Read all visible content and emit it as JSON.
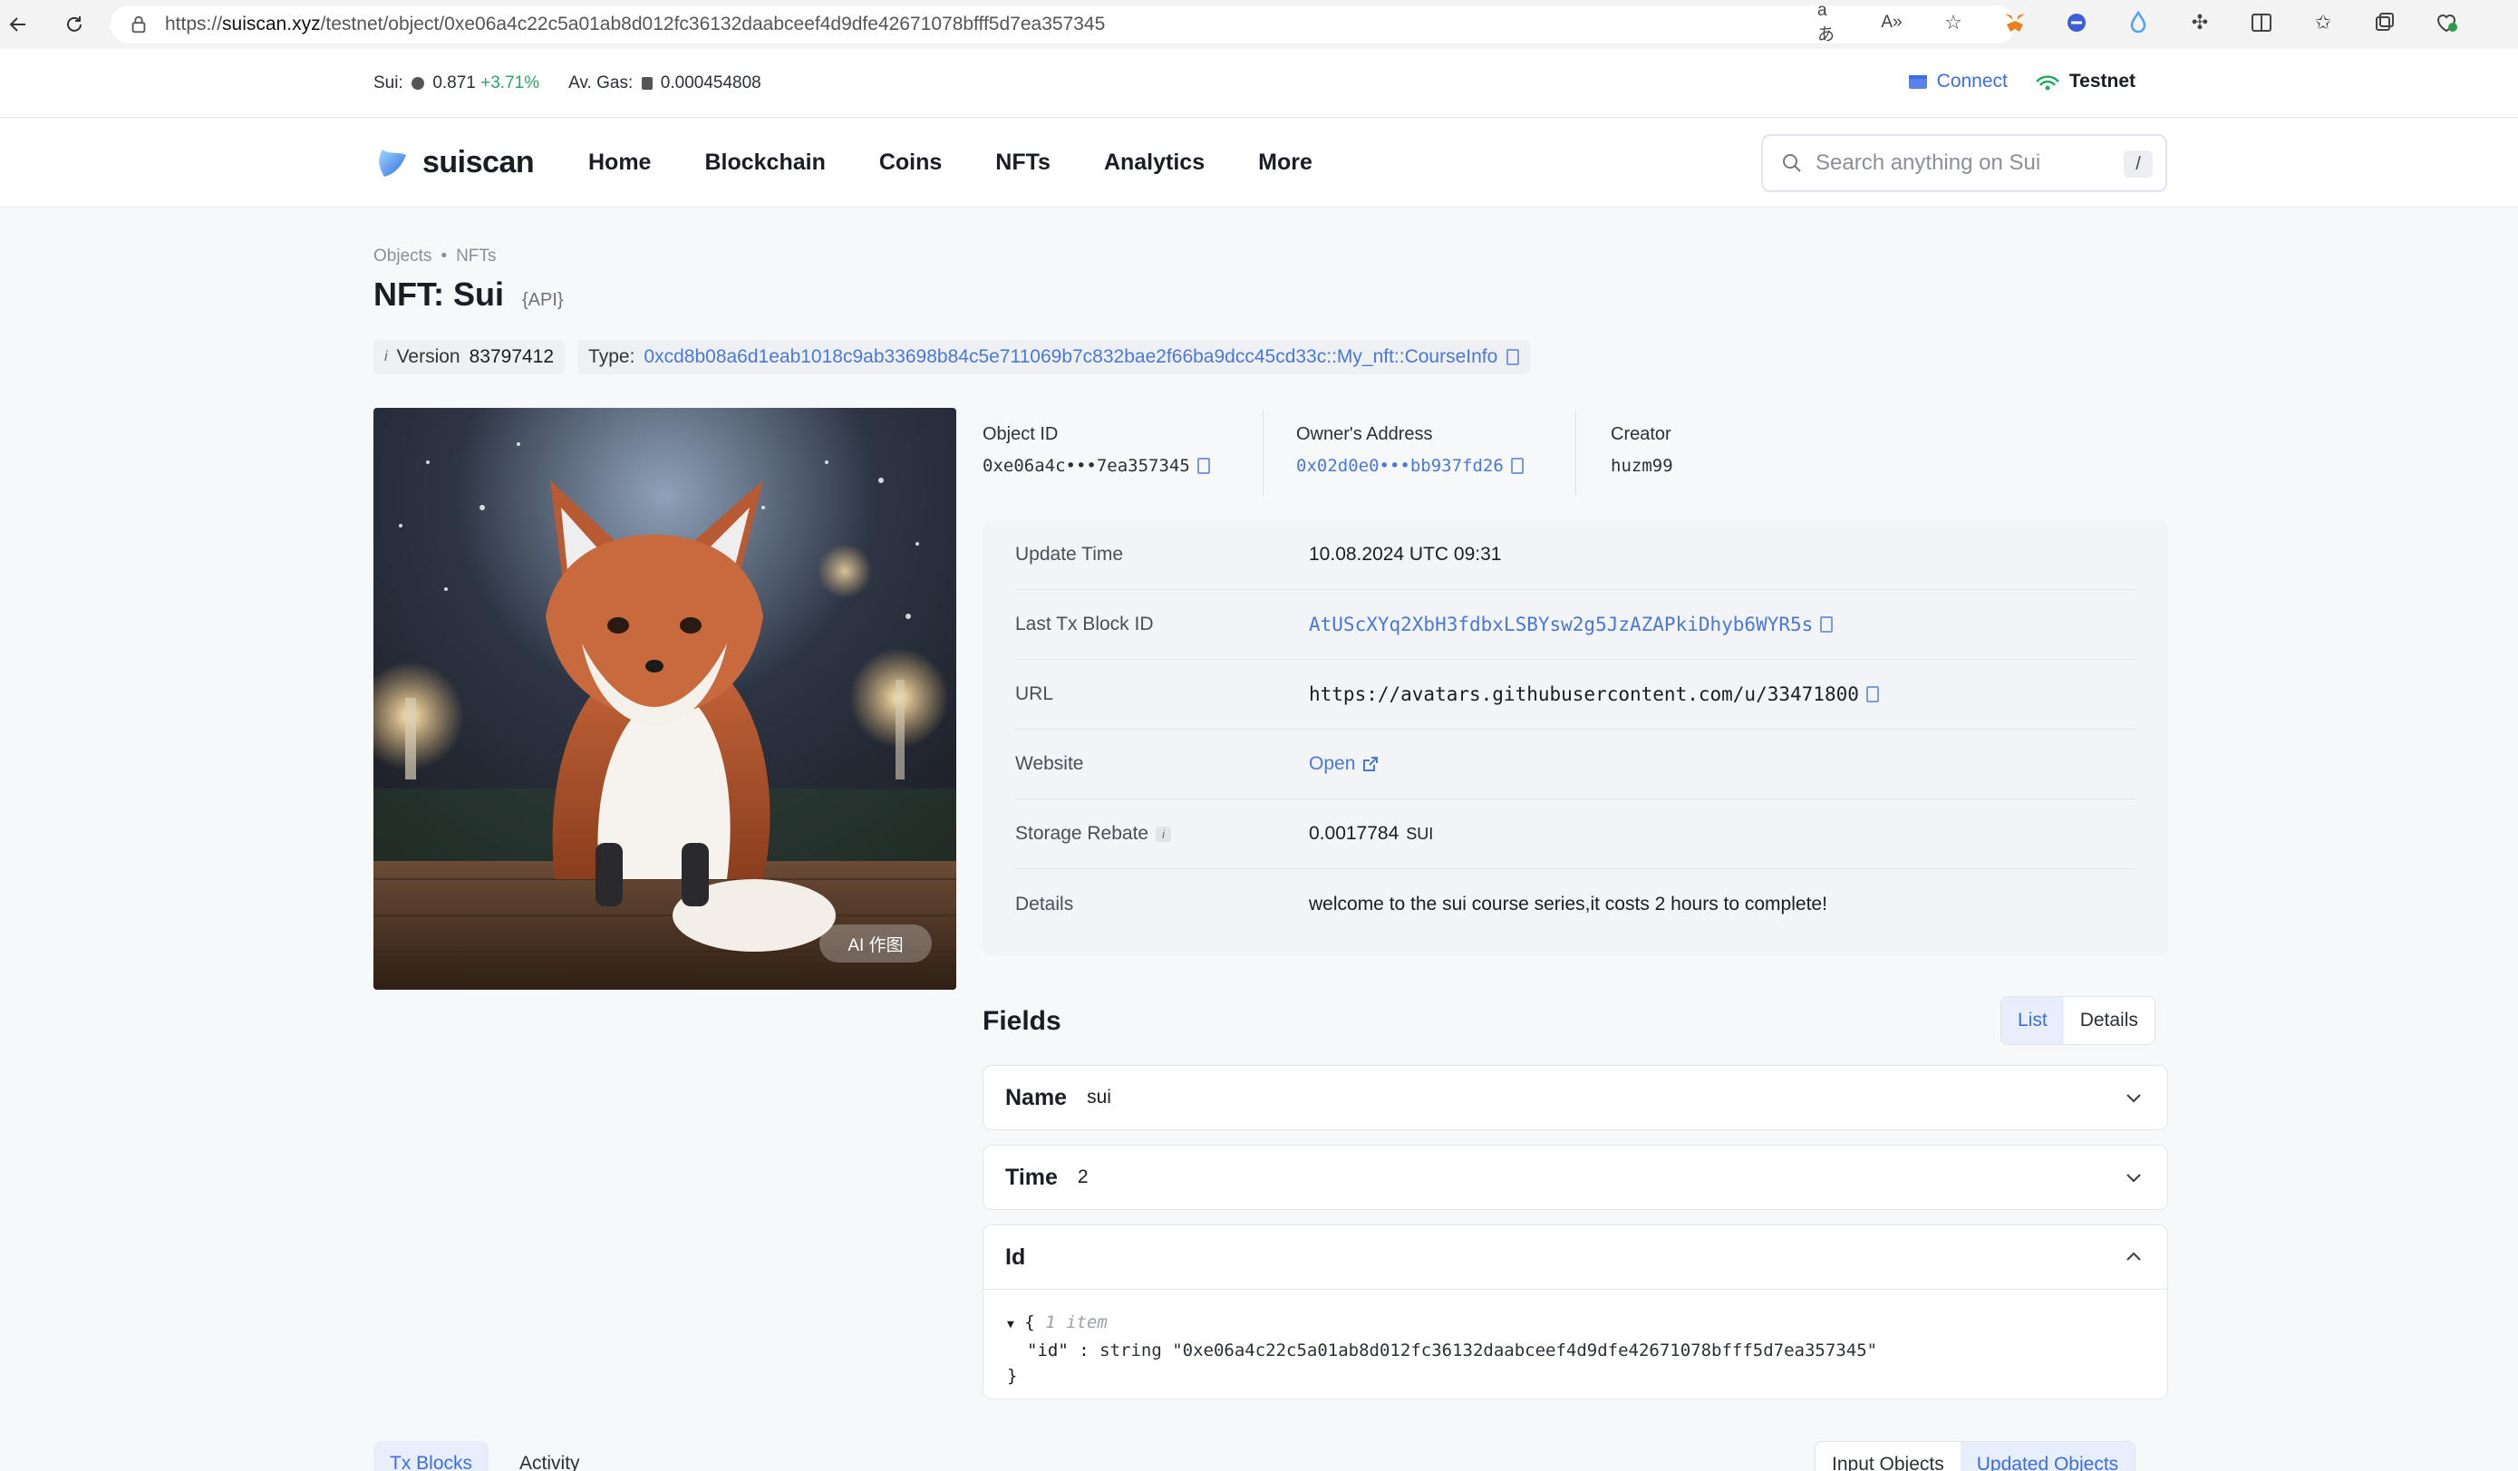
{
  "browser": {
    "url_prefix": "https://",
    "url_host": "suiscan.xyz",
    "url_path": "/testnet/object/0xe06a4c22c5a01ab8d012fc36132daabceef4d9dfe42671078bfff5d7ea357345"
  },
  "ticker": {
    "sui_label": "Sui:",
    "sui_price": "0.871",
    "sui_change": "+3.71%",
    "gas_label": "Av. Gas:",
    "gas_value": "0.000454808",
    "connect_label": "Connect",
    "network_label": "Testnet"
  },
  "nav": {
    "brand": "suiscan",
    "items": [
      "Home",
      "Blockchain",
      "Coins",
      "NFTs",
      "Analytics",
      "More"
    ],
    "search_placeholder": "Search anything on Sui",
    "search_shortcut": "/"
  },
  "breadcrumb": {
    "items": [
      "Objects",
      "NFTs"
    ],
    "separator": "•"
  },
  "page": {
    "title": "NFT: Sui",
    "api_tag": "{API}",
    "version_label": "Version",
    "version_value": "83797412",
    "type_label": "Type:",
    "type_value": "0xcd8b08a6d1eab1018c9ab33698b84c5e711069b7c832bae2f66ba9dcc45cd33c::My_nft::CourseInfo",
    "image_badge": "AI 作图"
  },
  "ids": {
    "object_id_label": "Object ID",
    "object_id_value": "0xe06a4c•••7ea357345",
    "owner_label": "Owner's Address",
    "owner_value": "0x02d0e0•••bb937fd26",
    "creator_label": "Creator",
    "creator_value": "huzm99"
  },
  "properties": [
    {
      "label": "Update Time",
      "value": "10.08.2024 UTC 09:31"
    },
    {
      "label": "Last Tx Block ID",
      "value": "AtUScXYq2XbH3fdbxLSBYsw2g5JzAZAPkiDhyb6WYR5s"
    },
    {
      "label": "URL",
      "value": "https://avatars.githubusercontent.com/u/33471800"
    },
    {
      "label": "Website",
      "value": "Open"
    },
    {
      "label": "Storage Rebate",
      "value": "0.0017784",
      "unit": "SUI"
    },
    {
      "label": "Details",
      "value": "welcome to the sui course series,it costs 2 hours to complete!"
    }
  ],
  "fields": {
    "title": "Fields",
    "view_list": "List",
    "view_details": "Details",
    "items": [
      {
        "name": "Name",
        "value": "sui"
      },
      {
        "name": "Time",
        "value": "2"
      },
      {
        "name": "Id",
        "value": ""
      }
    ],
    "json": {
      "open_brace": "{",
      "count": "1 item",
      "key": "\"id\"",
      "colon": ":",
      "type": "string",
      "value": "\"0xe06a4c22c5a01ab8d012fc36132daabceef4d9dfe42671078bfff5d7ea357345\"",
      "close_brace": "}"
    }
  },
  "bottom": {
    "tabs": [
      "Tx Blocks",
      "Activity"
    ],
    "right_tabs": [
      "Input Objects",
      "Updated Objects"
    ]
  },
  "colors": {
    "accent": "#3b6ee6",
    "link": "#4a78d9",
    "positive": "#28a86a"
  }
}
